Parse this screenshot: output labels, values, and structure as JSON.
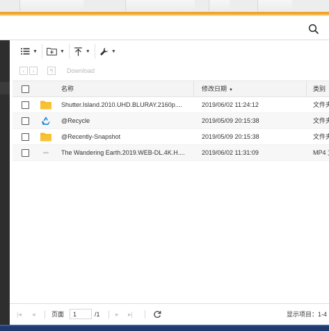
{
  "toolbar": {
    "list_view_icon": "list-icon",
    "new_folder_icon": "folder-plus-icon",
    "upload_icon": "upload-icon",
    "tools_icon": "wrench-icon"
  },
  "nav": {
    "download_label": "Download"
  },
  "table": {
    "columns": {
      "name": "名称",
      "modified": "修改日期",
      "type": "类别"
    },
    "rows": [
      {
        "icon": "folder-icon",
        "name": "Shutter.Island.2010.UHD.BLURAY.2160p....",
        "modified": "2019/06/02 11:24:12",
        "type": "文件夹"
      },
      {
        "icon": "recycle-icon",
        "name": "@Recycle",
        "modified": "2019/05/09 20:15:38",
        "type": "文件夹"
      },
      {
        "icon": "folder-icon",
        "name": "@Recently-Snapshot",
        "modified": "2019/05/09 20:15:38",
        "type": "文件夹"
      },
      {
        "icon": "video-file-icon",
        "name": "The Wandering Earth.2019.WEB-DL.4K.H....",
        "modified": "2019/06/02 11:31:09",
        "type": "MP4 文"
      }
    ]
  },
  "pager": {
    "page_label": "页面",
    "page_value": "1",
    "total_label": "/1",
    "summary": "显示项目：1-4"
  },
  "colors": {
    "accent": "#f1a52a",
    "folder": "#f5b91f",
    "recycle": "#2a8fd6"
  }
}
